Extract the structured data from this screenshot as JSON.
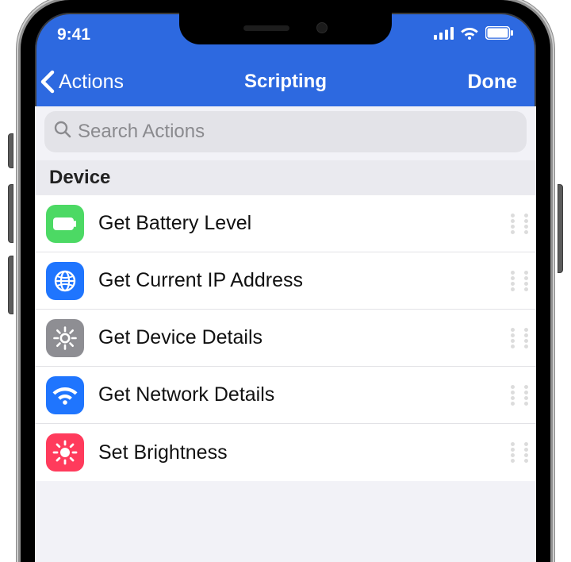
{
  "status": {
    "time": "9:41"
  },
  "nav": {
    "back_label": "Actions",
    "title": "Scripting",
    "done_label": "Done"
  },
  "search": {
    "placeholder": "Search Actions"
  },
  "section": {
    "title": "Device"
  },
  "actions": [
    {
      "title": "Get Battery Level",
      "icon": "battery-icon",
      "color": "#4cd964"
    },
    {
      "title": "Get Current IP Address",
      "icon": "globe-icon",
      "color": "#1f75fe"
    },
    {
      "title": "Get Device Details",
      "icon": "gear-icon",
      "color": "#8e8e93"
    },
    {
      "title": "Get Network Details",
      "icon": "wifi-icon",
      "color": "#1f75fe"
    },
    {
      "title": "Set Brightness",
      "icon": "brightness-icon",
      "color": "#ff3b5c"
    }
  ]
}
